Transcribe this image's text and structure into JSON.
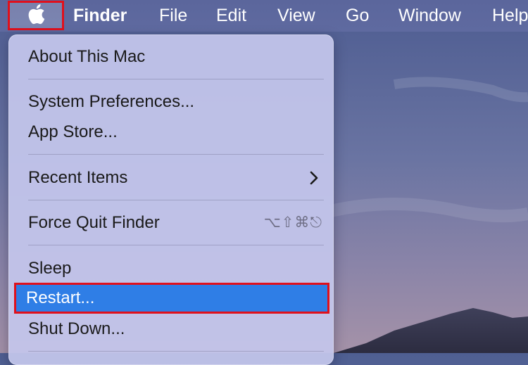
{
  "menubar": {
    "apple_icon": "apple-logo-icon",
    "items": [
      "Finder",
      "File",
      "Edit",
      "View",
      "Go",
      "Window",
      "Help"
    ]
  },
  "apple_menu": {
    "items": [
      {
        "label": "About This Mac"
      },
      {
        "label": "System Preferences..."
      },
      {
        "label": "App Store..."
      },
      {
        "label": "Recent Items",
        "submenu_icon": "chevron-right-icon"
      },
      {
        "label": "Force Quit Finder",
        "shortcut": "⌥⇧⌘⎋"
      },
      {
        "label": "Sleep"
      },
      {
        "label": "Restart..."
      },
      {
        "label": "Shut Down..."
      }
    ]
  },
  "colors": {
    "highlight": "#2f7ee6",
    "annotation_border": "#e0101c",
    "menubar": "#5d68a0"
  }
}
